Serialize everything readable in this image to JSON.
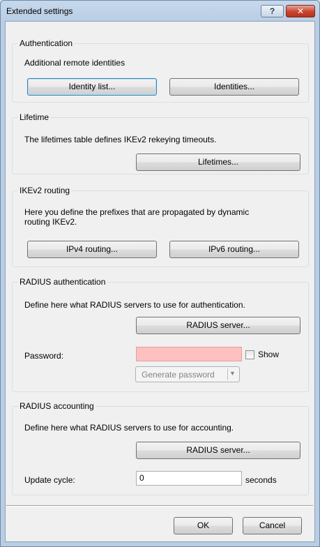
{
  "window": {
    "title": "Extended settings",
    "help_glyph": "?",
    "close_glyph": "✕"
  },
  "authentication": {
    "group_title": "Authentication",
    "description": "Additional remote identities",
    "identity_list_label": "Identity list...",
    "identities_label": "Identities..."
  },
  "lifetime": {
    "group_title": "Lifetime",
    "description": "The lifetimes table defines IKEv2 rekeying timeouts.",
    "lifetimes_label": "Lifetimes..."
  },
  "ikev2_routing": {
    "group_title": "IKEv2 routing",
    "description_line1": "Here you define the prefixes that are propagated by dynamic",
    "description_line2": "routing IKEv2.",
    "ipv4_label": "IPv4 routing...",
    "ipv6_label": "IPv6 routing..."
  },
  "radius_auth": {
    "group_title": "RADIUS authentication",
    "description": "Define here what RADIUS servers to use for authentication.",
    "server_label": "RADIUS server...",
    "password_label": "Password:",
    "password_value": "",
    "show_label": "Show",
    "generate_label": "Generate password",
    "generate_arrow": "▼"
  },
  "radius_acct": {
    "group_title": "RADIUS accounting",
    "description": "Define here what RADIUS servers to use for accounting.",
    "server_label": "RADIUS server...",
    "update_label": "Update cycle:",
    "update_value": "0",
    "unit_label": "seconds"
  },
  "footer": {
    "ok_label": "OK",
    "cancel_label": "Cancel"
  }
}
